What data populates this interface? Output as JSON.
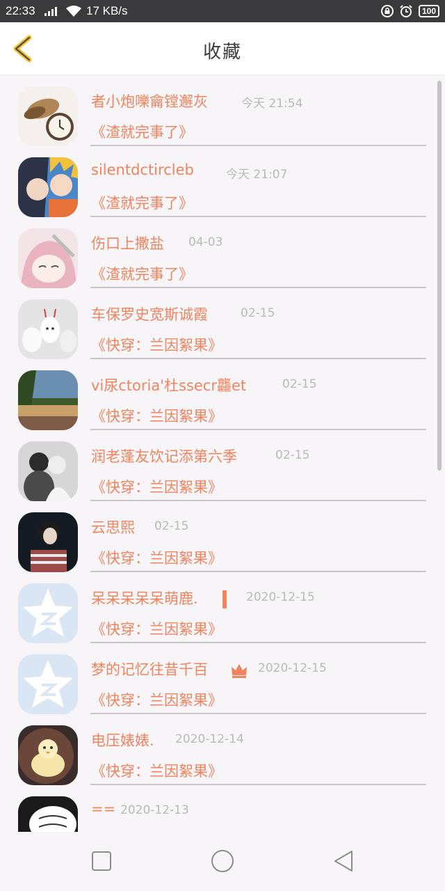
{
  "status_bar": {
    "time": "22:33",
    "network_speed": "17 KB/s",
    "battery": "100"
  },
  "header": {
    "title": "收藏"
  },
  "favorites": [
    {
      "name": "者小炮嚛龠镗邂灰",
      "date": "今天 21:54",
      "book": "《渣就完事了》"
    },
    {
      "name": "silentdctircleb",
      "date": "今天 21:07",
      "book": "《渣就完事了》"
    },
    {
      "name": "伤口上撒盐",
      "date": "04-03",
      "book": "《渣就完事了》"
    },
    {
      "name": "车保罗史宽斯诚霞",
      "date": "02-15",
      "book": "《快穿：兰因絮果》"
    },
    {
      "name": "vi尿ctoria'杜ssecr龘et",
      "date": "02-15",
      "book": "《快穿：兰因絮果》"
    },
    {
      "name": "润老蓬友饮记添第六季",
      "date": "02-15",
      "book": "《快穿：兰因絮果》"
    },
    {
      "name": "云思熙",
      "date": "02-15",
      "book": "《快穿：兰因絮果》"
    },
    {
      "name": "呆呆呆呆呆萌鹿.",
      "date": "2020-12-15",
      "book": "《快穿：兰因絮果》"
    },
    {
      "name": "梦的记忆往昔千百",
      "date": "2020-12-15",
      "book": "《快穿：兰因絮果》"
    },
    {
      "name": "电压婊婊.",
      "date": "2020-12-14",
      "book": "《快穿：兰因絮果》"
    },
    {
      "name": "==",
      "date": "2020-12-13",
      "book": ""
    }
  ],
  "colors": {
    "accent": "#f0845f",
    "back_icon": "#f3c227",
    "date_text": "#b9b9b9"
  },
  "icons": {
    "back": "chevron-left-icon",
    "nav_recent": "square-icon",
    "nav_home": "circle-icon",
    "nav_back": "triangle-back-icon",
    "row7_suffix": "bar-mark-icon",
    "row8_suffix": "crown-icon"
  }
}
